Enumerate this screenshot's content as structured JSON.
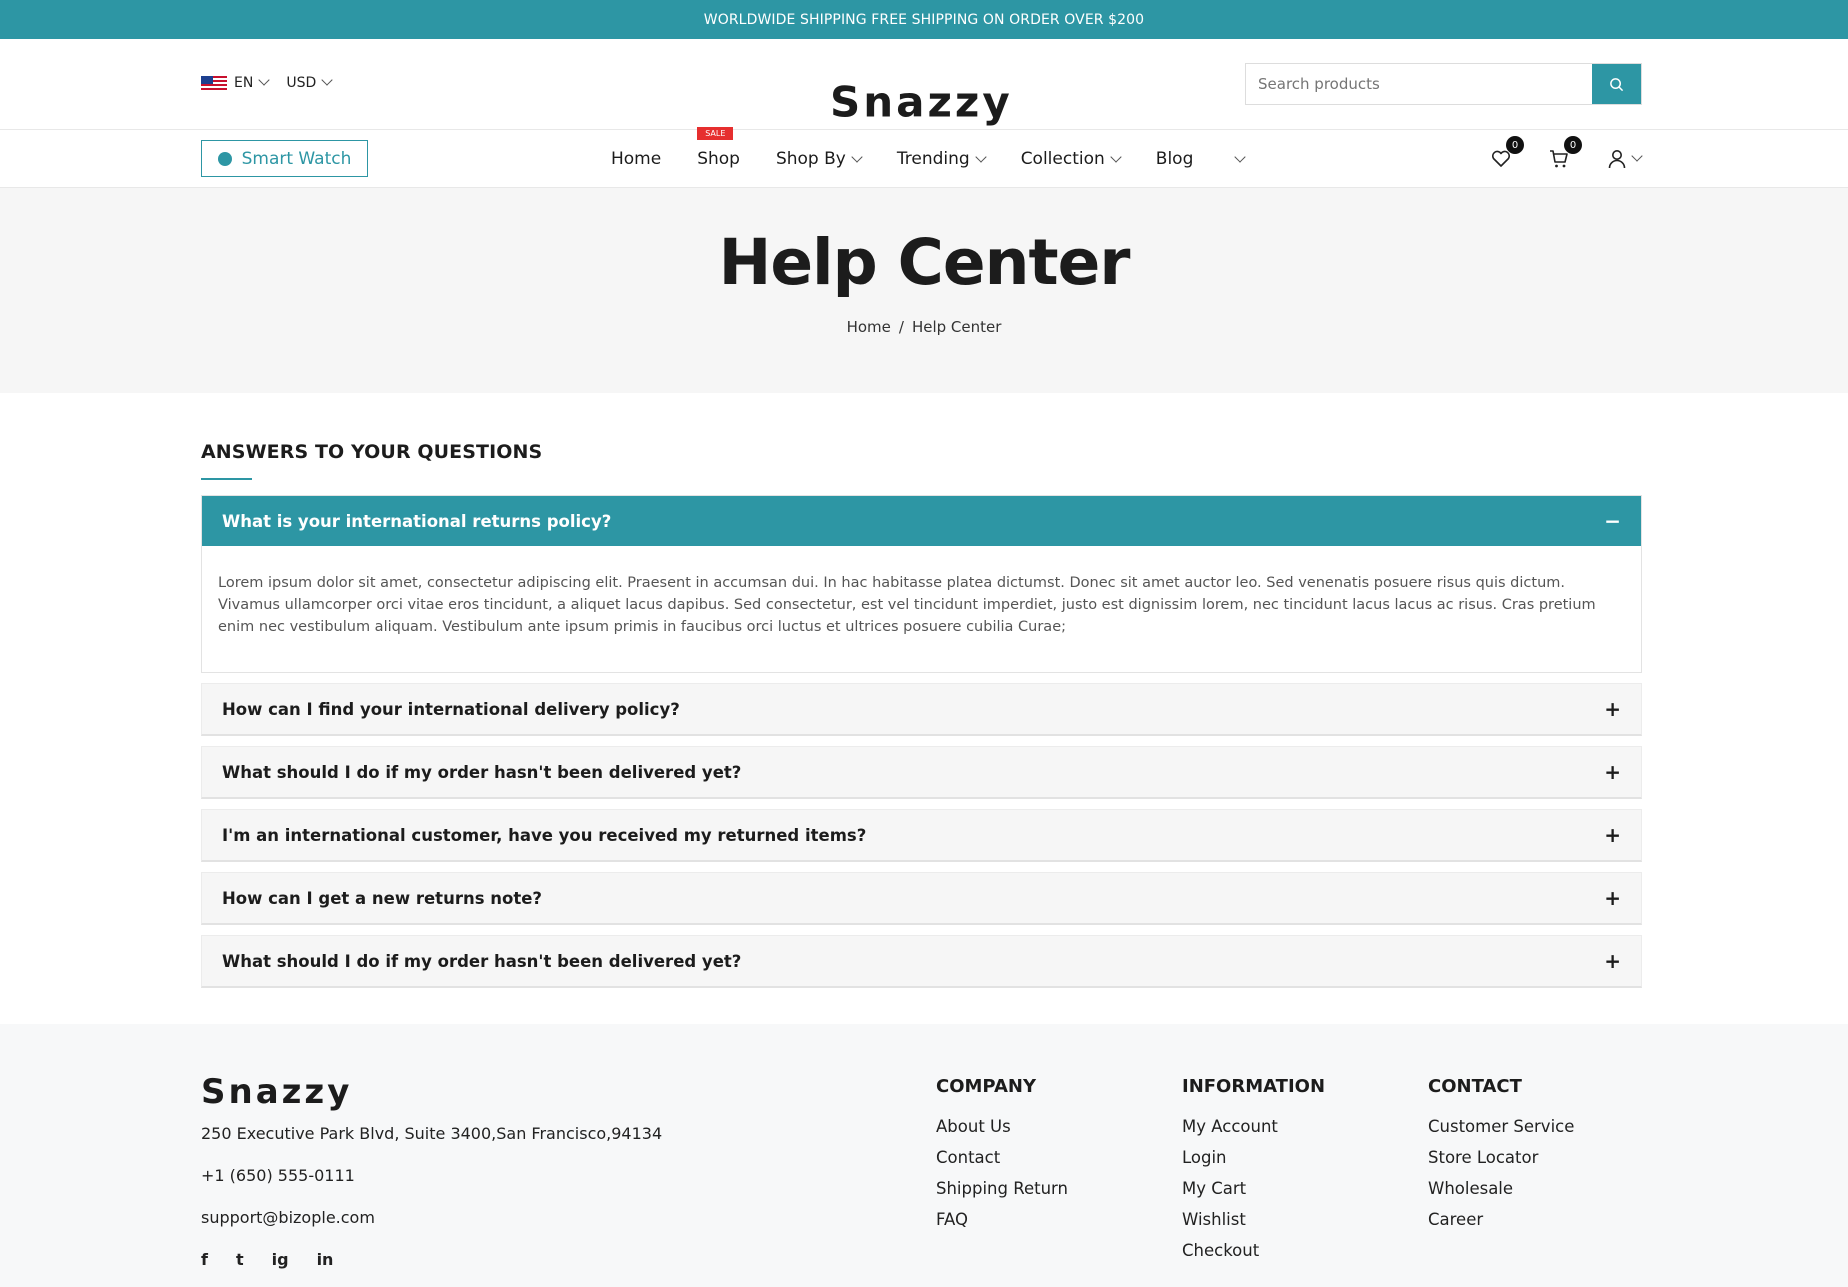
{
  "topbar": {
    "text": "WORLDWIDE SHIPPING  FREE SHIPPING ON ORDER OVER $200"
  },
  "header": {
    "language": "EN",
    "currency": "USD",
    "logo": "Snazzy",
    "search_placeholder": "Search products"
  },
  "nav": {
    "category_button": "Smart Watch",
    "items": [
      {
        "label": "Home",
        "dropdown": false
      },
      {
        "label": "Shop",
        "dropdown": false,
        "badge": "SALE"
      },
      {
        "label": "Shop By",
        "dropdown": true
      },
      {
        "label": "Trending",
        "dropdown": true
      },
      {
        "label": "Collection",
        "dropdown": true
      },
      {
        "label": "Blog",
        "dropdown": false
      }
    ],
    "wishlist_count": "0",
    "cart_count": "0"
  },
  "hero": {
    "title": "Help Center",
    "breadcrumb_home": "Home",
    "breadcrumb_sep": "/",
    "breadcrumb_current": "Help Center"
  },
  "faq": {
    "heading": "ANSWERS TO YOUR QUESTIONS",
    "open": {
      "question": "What is your international returns policy?",
      "answer": "Lorem ipsum dolor sit amet, consectetur adipiscing elit. Praesent in accumsan dui. In hac habitasse platea dictumst. Donec sit amet auctor leo. Sed venenatis posuere risus quis dictum. Vivamus ullamcorper orci vitae eros tincidunt, a aliquet lacus dapibus. Sed consectetur, est vel tincidunt imperdiet, justo est dignissim lorem, nec tincidunt lacus lacus ac risus. Cras pretium enim nec vestibulum aliquam. Vestibulum ante ipsum primis in faucibus orci luctus et ultrices posuere cubilia Curae;",
      "sign": "−"
    },
    "items": [
      {
        "question": "How can I find your international delivery policy?",
        "sign": "+"
      },
      {
        "question": "What should I do if my order hasn't been delivered yet?",
        "sign": "+"
      },
      {
        "question": "I'm an international customer, have you received my returned items?",
        "sign": "+"
      },
      {
        "question": "How can I get a new returns note?",
        "sign": "+"
      },
      {
        "question": "What should I do if my order hasn't been delivered yet?",
        "sign": "+"
      }
    ]
  },
  "footer": {
    "logo": "Snazzy",
    "address": "250 Executive Park Blvd, Suite 3400,San Francisco,94134",
    "phone": "+1 (650) 555-0111",
    "email": "support@bizople.com",
    "social": [
      "f",
      "t",
      "ig",
      "in"
    ],
    "company": {
      "title": "COMPANY",
      "links": [
        "About Us",
        "Contact",
        "Shipping Return",
        "FAQ"
      ]
    },
    "information": {
      "title": "INFORMATION",
      "links": [
        "My Account",
        "Login",
        "My Cart",
        "Wishlist",
        "Checkout"
      ]
    },
    "contact": {
      "title": "CONTACT",
      "links": [
        "Customer Service",
        "Store Locator",
        "Wholesale",
        "Career"
      ]
    }
  },
  "colors": {
    "accent": "#2d96a4",
    "sale": "#e62f2f",
    "text": "#1c1c1c"
  }
}
